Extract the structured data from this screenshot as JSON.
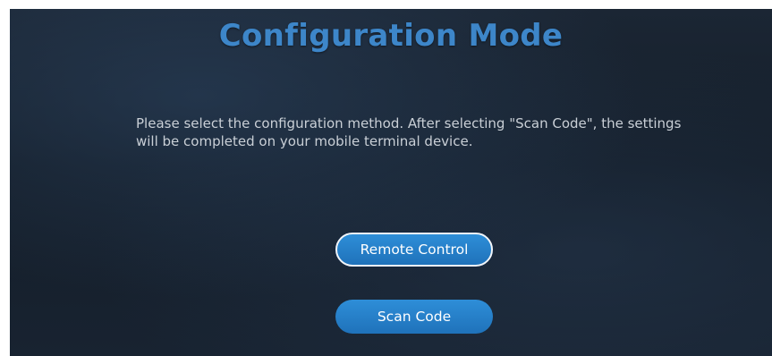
{
  "screen": {
    "title": "Configuration Mode",
    "description": "Please select the configuration method. After selecting \"Scan Code\", the settings will be completed on your mobile terminal device."
  },
  "options": {
    "remote_control_label": "Remote Control",
    "scan_code_label": "Scan Code",
    "focused": "remote_control"
  },
  "colors": {
    "title": "#3d86c9",
    "button": "#2782cb",
    "background": "#182331",
    "text": "#c9cfd6"
  }
}
